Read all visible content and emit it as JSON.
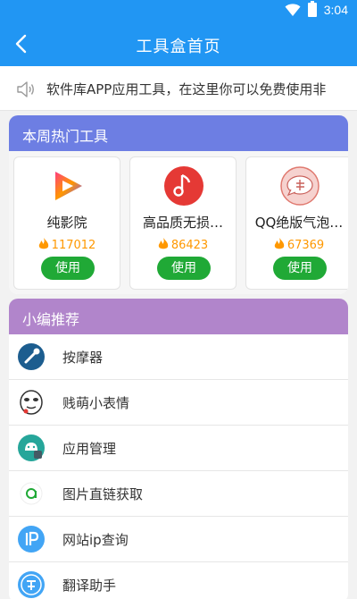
{
  "status_bar": {
    "time": "3:04"
  },
  "toolbar": {
    "title": "工具盒首页"
  },
  "notice": {
    "text": "软件库APP应用工具，在这里你可以免费使用非"
  },
  "hot_tools": {
    "header": "本周热门工具",
    "cards": [
      {
        "name": "纯影院",
        "count": "117012",
        "button": "使用",
        "icon": "play-icon"
      },
      {
        "name": "高品质无损…",
        "count": "86423",
        "button": "使用",
        "icon": "music-note-icon"
      },
      {
        "name": "QQ绝版气泡…",
        "count": "67369",
        "button": "使用",
        "icon": "bubble-icon"
      }
    ]
  },
  "recommend": {
    "header": "小编推荐",
    "items": [
      {
        "label": "按摩器",
        "icon": "massager-icon"
      },
      {
        "label": "贱萌小表情",
        "icon": "emoji-face-icon"
      },
      {
        "label": "应用管理",
        "icon": "android-icon"
      },
      {
        "label": "图片直链获取",
        "icon": "image-link-icon"
      },
      {
        "label": "网站ip查询",
        "icon": "ip-icon"
      },
      {
        "label": "翻译助手",
        "icon": "translate-icon"
      }
    ]
  },
  "colors": {
    "primary": "#2196f3",
    "hot_header": "#6d7ee3",
    "rec_header": "#b185cb",
    "use_button": "#20a936",
    "count": "#ff9800"
  }
}
